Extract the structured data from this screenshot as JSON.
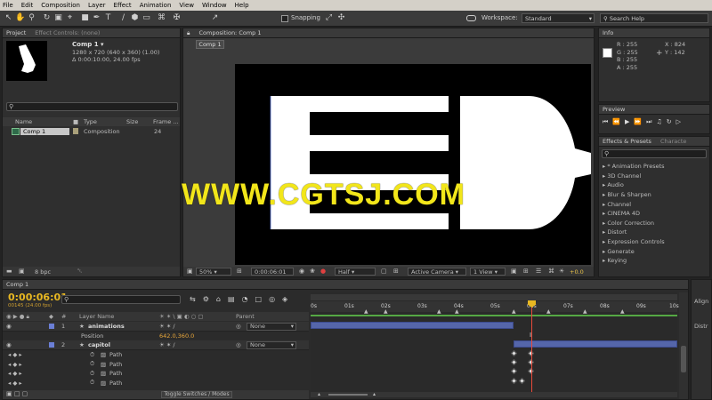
{
  "menu": [
    "File",
    "Edit",
    "Composition",
    "Layer",
    "Effect",
    "Animation",
    "View",
    "Window",
    "Help"
  ],
  "toolbar": {
    "snapping_label": "Snapping",
    "workspace_label": "Workspace:",
    "workspace_value": "Standard",
    "search_help_placeholder": "Search Help"
  },
  "project_panel": {
    "tabs": [
      "Project",
      "Effect Controls: (none)"
    ],
    "comp_name": "Comp 1 ▾",
    "comp_size": "1280 x 720  (640 x 360) (1.00)",
    "comp_duration": "Δ 0:00:10:00, 24.00 fps",
    "columns": [
      "Name",
      "Type",
      "Size",
      "Frame ..."
    ],
    "items": [
      {
        "name": "Comp 1",
        "type": "Composition",
        "size": "",
        "frame": "24"
      }
    ],
    "bpc_label": "8 bpc"
  },
  "composition_panel": {
    "tab": "Composition: Comp 1",
    "subtab": "Comp 1",
    "zoom": "50%",
    "timecode": "0:00:06:01",
    "resolution": "Half",
    "camera": "Active Camera",
    "view": "1 View",
    "exposure": "+0.0"
  },
  "info_panel": {
    "tab": "Info",
    "r": "R : 255",
    "g": "G : 255",
    "b": "B : 255",
    "a": "A : 255",
    "x": "X : 824",
    "y": "Y : 142",
    "swatch_color": "#ffffff"
  },
  "preview_panel": {
    "tab": "Preview"
  },
  "effects_panel": {
    "tabs": [
      "Effects & Presets",
      "Characte"
    ],
    "items": [
      "* Animation Presets",
      "3D Channel",
      "Audio",
      "Blur & Sharpen",
      "Channel",
      "CINEMA 4D",
      "Color Correction",
      "Distort",
      "Expression Controls",
      "Generate",
      "Keying"
    ]
  },
  "timeline": {
    "tab": "Comp 1",
    "timecode": "0:00:06:01",
    "frame_info": "00145 (24.00 fps)",
    "header_cols": {
      "layer_name": "Layer Name",
      "parent": "Parent",
      "num": "#"
    },
    "ruler_labels": [
      "0s",
      "01s",
      "02s",
      "03s",
      "04s",
      "05s",
      "06s",
      "07s",
      "08s",
      "09s",
      "10s"
    ],
    "toggle_label": "Toggle Switches / Modes",
    "layers": [
      {
        "num": "1",
        "name": "animations",
        "parent": "None"
      },
      {
        "prop": "Position",
        "value": "642.0,360.0"
      },
      {
        "num": "2",
        "name": "capitol",
        "parent": "None"
      },
      {
        "prop": "Path"
      },
      {
        "prop": "Path"
      },
      {
        "prop": "Path"
      },
      {
        "prop": "Path"
      }
    ]
  },
  "right_edge_labels": [
    "Align",
    "Distr"
  ],
  "watermark": "WWW.CGTSJ.COM",
  "colors": {
    "accent_timecode": "#e8b822",
    "layer_bar": "#5566aa",
    "playhead": "#e84a3a",
    "work_area": "#55a844",
    "watermark": "#f2e61a"
  }
}
